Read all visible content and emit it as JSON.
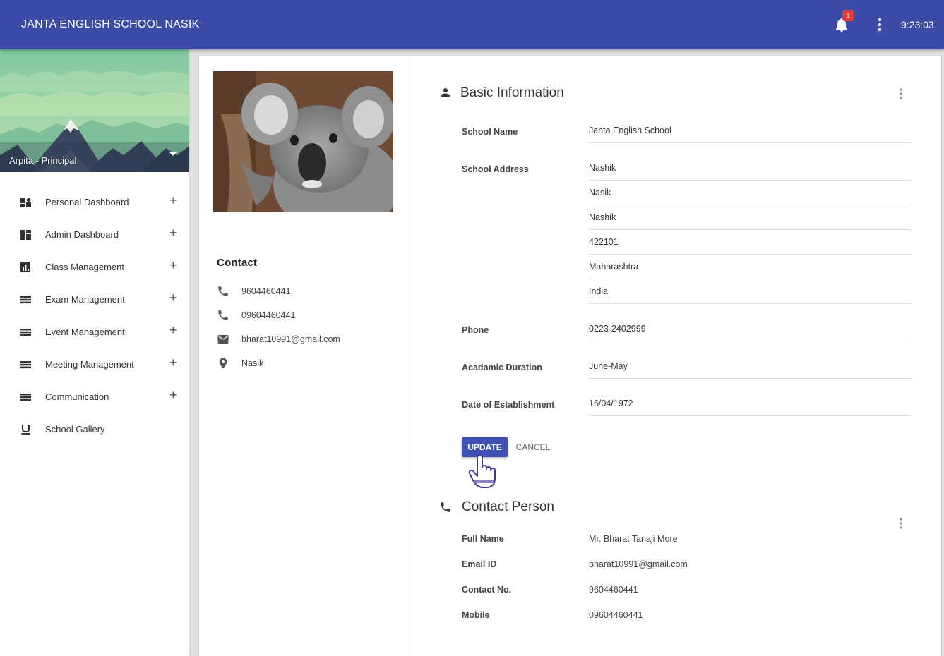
{
  "app": {
    "title": "JANTA ENGLISH SCHOOL NASIK",
    "notification_count": "1",
    "clock": "9:23:03"
  },
  "sidebar": {
    "user": "Arpita - Principal",
    "items": [
      {
        "label": "Personal Dashboard",
        "icon": "dashboard-alt-icon"
      },
      {
        "label": "Admin Dashboard",
        "icon": "dashboard-icon"
      },
      {
        "label": "Class Management",
        "icon": "bar-chart-icon"
      },
      {
        "label": "Exam Management",
        "icon": "list-icon"
      },
      {
        "label": "Event Management",
        "icon": "list-icon"
      },
      {
        "label": "Meeting Management",
        "icon": "list-icon"
      },
      {
        "label": "Communication",
        "icon": "list-icon"
      },
      {
        "label": "School Gallery",
        "icon": "underline-icon"
      }
    ]
  },
  "contact": {
    "title": "Contact",
    "phone1": "9604460441",
    "phone2": "09604460441",
    "email": "bharat10991@gmail.com",
    "location": "Nasik"
  },
  "basic_info": {
    "title": "Basic Information",
    "school_name_label": "School Name",
    "school_name": "Janta English School",
    "school_address_label": "School Address",
    "address": [
      "Nashik",
      "Nasik",
      "Nashik",
      "422101",
      "Maharashtra",
      "India"
    ],
    "phone_label": "Phone",
    "phone": "0223-2402999",
    "duration_label": "Acadamic Duration",
    "duration": "June-May",
    "established_label": "Date of Establishment",
    "established": "16/04/1972",
    "update_label": "UPDATE",
    "cancel_label": "CANCEL"
  },
  "contact_person": {
    "title": "Contact Person",
    "full_name_label": "Full Name",
    "full_name": "Mr. Bharat Tanaji More",
    "email_label": "Email ID",
    "email": "bharat10991@gmail.com",
    "contact_label": "Contact No.",
    "contact": "9604460441",
    "mobile_label": "Mobile",
    "mobile": "09604460441"
  },
  "colors": {
    "primary": "#3c4ba6",
    "button": "#3f51b5",
    "badge": "#e53935"
  }
}
